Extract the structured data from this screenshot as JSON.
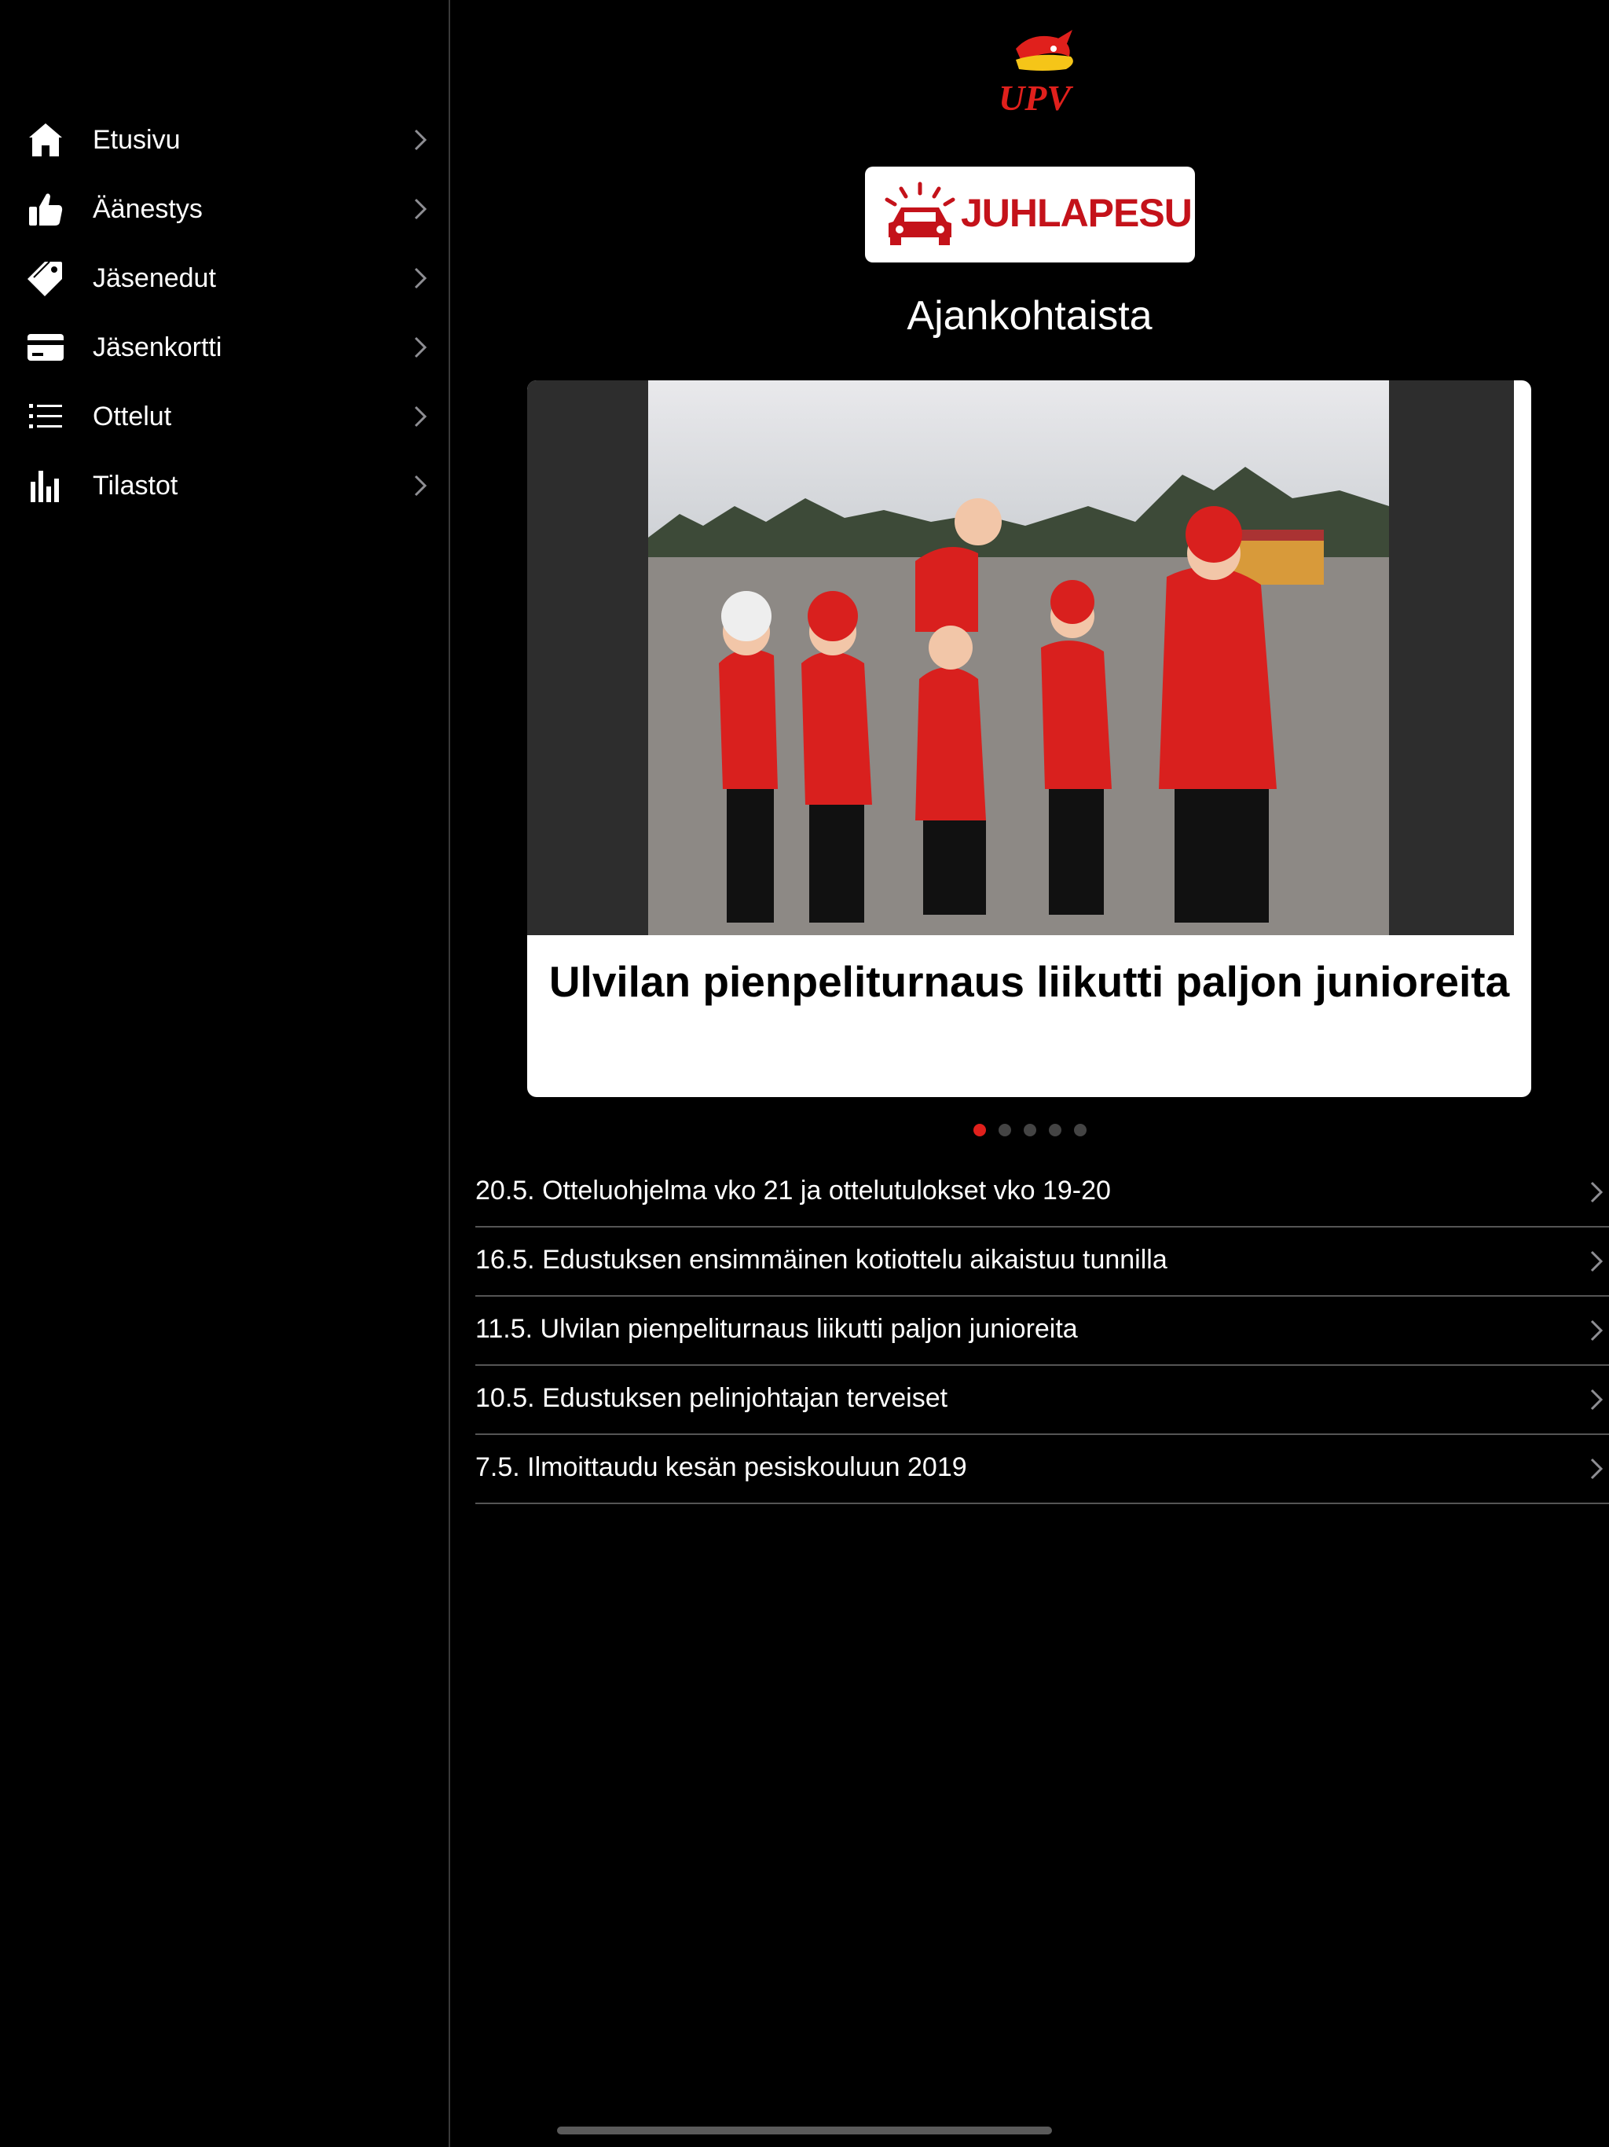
{
  "sidebar": {
    "items": [
      {
        "label": "Etusivu",
        "icon": "home-icon"
      },
      {
        "label": "Äänestys",
        "icon": "thumbs-up-icon"
      },
      {
        "label": "Jäsenedut",
        "icon": "tag-icon"
      },
      {
        "label": "Jäsenkortti",
        "icon": "credit-card-icon"
      },
      {
        "label": "Ottelut",
        "icon": "list-icon"
      },
      {
        "label": "Tilastot",
        "icon": "bar-chart-icon"
      }
    ]
  },
  "header": {
    "logo_text": "UPV",
    "sponsor_text": "JUHLAPESU"
  },
  "main": {
    "section_title": "Ajankohtaista",
    "featured": {
      "headline": "Ulvilan pienpeliturnaus liikutti paljon junioreita"
    },
    "carousel": {
      "page_count": 5,
      "active_index": 0
    },
    "news": [
      "20.5. Otteluohjelma vko 21 ja ottelutulokset vko 19-20",
      "16.5. Edustuksen ensimmäinen kotiottelu aikaistuu tunnilla",
      "11.5. Ulvilan pienpeliturnaus liikutti paljon junioreita",
      "10.5. Edustuksen pelinjohtajan terveiset",
      "7.5. Ilmoittaudu kesän pesiskouluun 2019"
    ]
  },
  "colors": {
    "background": "#000000",
    "accent": "#e0201c",
    "sponsor_red": "#c4121a"
  }
}
